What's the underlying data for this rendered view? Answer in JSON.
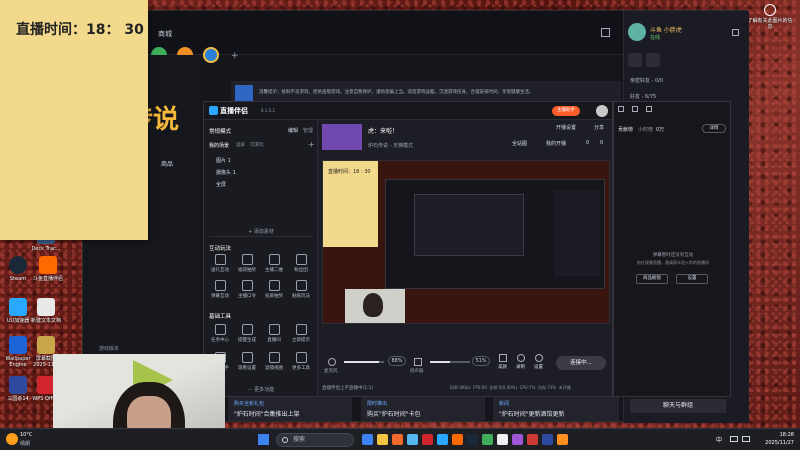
{
  "sticky_note": {
    "label": "直播时间：",
    "time": "18： 30"
  },
  "desktop": {
    "icons": [
      {
        "name": "Deck Trac...",
        "icon": "deck-tracker-icon",
        "color": "#3a5f8c"
      },
      {
        "name": "Steam",
        "icon": "steam-icon",
        "color": "#1b2838"
      },
      {
        "name": "斗鱼直播伴侣",
        "icon": "douyu-icon",
        "color": "#ff6a00"
      },
      {
        "name": "UU加速器",
        "icon": "uu-icon",
        "color": "#2aa8ff"
      },
      {
        "name": "新建文本文档",
        "icon": "text-doc-icon",
        "color": "#e8e8e8"
      },
      {
        "name": "Wallpaper Engine",
        "icon": "wallpaper-icon",
        "color": "#1d64d6"
      },
      {
        "name": "屏幕截图 2025-11...",
        "icon": "screenshot-icon",
        "color": "#c9a64a"
      },
      {
        "name": "三国杀14",
        "icon": "sgs-icon",
        "color": "#2d4a9e"
      },
      {
        "name": "WPS Office",
        "icon": "wps-icon",
        "color": "#d0252d"
      }
    ],
    "corner_help": "了解有关此图片的信息"
  },
  "client": {
    "nav_label": "商城",
    "version_label": "游戏版本",
    "game_title": "传说",
    "game_sub": "商品",
    "notice": "温馨提示：抵制不良游戏，拒绝盗版游戏。注意自我保护，谨防受骗上当。适度游戏益脑，沉迷游戏伤身。合理安排时间，享受健康生活。",
    "user": {
      "name": "斗鱼 小胖虎",
      "status": "在线"
    },
    "friends": [
      {
        "label": "亲密好友 - 0/0"
      },
      {
        "label": "好友 - 6/75"
      }
    ],
    "bottom_cards": [
      {
        "tag": "购买全新礼包",
        "text": "\"炉石时间\"合集推出上架"
      },
      {
        "tag": "限时推出",
        "text": "购买\"炉石时间\"卡包"
      },
      {
        "tag": "新闻",
        "text": "\"炉石时间\"更新酒馆更新"
      }
    ],
    "chat_button": "聊天与群组"
  },
  "broadcast": {
    "app_title": "直播伴侣",
    "version": "8.1.5.2",
    "mode": "常规模式",
    "edit": "编辑",
    "manage": "管理",
    "my_scenes": "我的场景",
    "scene_tabs": [
      "竖屏",
      "可游玩"
    ],
    "sources": [
      "图片 1",
      "摄像头 1",
      "全屏"
    ],
    "add_source": "+ 添加素材",
    "section_interact": "互动玩法",
    "tools_a": [
      "送礼互动",
      "福袋抽奖",
      "主播二维",
      "粉丝团",
      "弹幕互动",
      "主播口令",
      "投屏抽奖",
      "贴纸玩法"
    ],
    "section_basic": "基础工具",
    "tools_b": [
      "任务中心",
      "提醒生成",
      "直播间",
      "立即提示",
      "房管助手",
      "观看设置",
      "滤镜视图",
      "更多工具"
    ],
    "more": "··· 更多功能",
    "stream_title": "虎：来啦！",
    "category": "炉石传说 - 天梯模式",
    "status_btn": "主播助手",
    "links": [
      "开播设置",
      "分享"
    ],
    "quality": "全站图",
    "playback": "我的开播",
    "counts": [
      "0",
      "0"
    ],
    "preview_note": "直播时间：18 : 30",
    "mic_label": "麦克风",
    "mic_level": "88%",
    "speaker_label": "扬声器",
    "speaker_level": "51%",
    "controls": [
      "美颜",
      "录制",
      "设置"
    ],
    "go_live": "连接中...",
    "status_text": "直播伴侣上不直播中(1:1)",
    "stats": [
      "码率:0Kb/s",
      "FPS:60",
      "丢帧:0(0.00%)",
      "CPU:7%",
      "内存:73%",
      "未开播"
    ]
  },
  "chat_panel": {
    "tabs": [
      "贡献榜",
      "小时榜"
    ],
    "count": "0万",
    "detail_btn": "详情",
    "empty": "弹幕暂时还没有互动",
    "hint": "前往观看直播，邀请观众进入你的直播间",
    "btn_a": "商品橱窗",
    "btn_b": "设置"
  },
  "taskbar": {
    "weather_temp": "10°C",
    "weather_desc": "晴朗",
    "search": "搜索",
    "apps": [
      "#3d82f0",
      "#f4c542",
      "#ef6a2a",
      "#55b7f0",
      "#d0252d",
      "#2aa8ff",
      "#ff6a00",
      "#1b2838",
      "#3fae5b",
      "#f0f0f0",
      "#9d57d6",
      "#ce3b35",
      "#2d4a9e",
      "#ff8f1f"
    ],
    "lang": "中",
    "time": "18:28",
    "date": "2025/11/27"
  }
}
